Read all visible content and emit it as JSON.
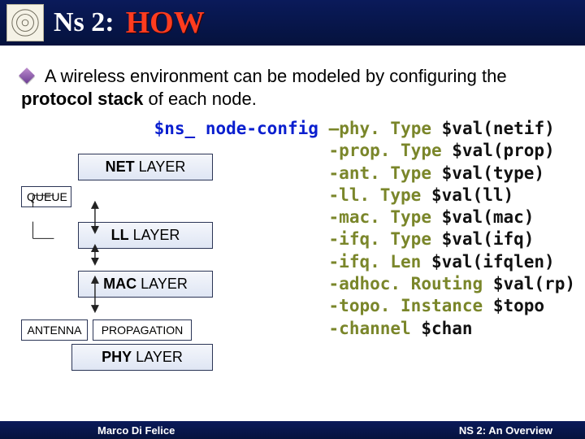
{
  "header": {
    "title_prefix": "Ns 2:",
    "title_highlight": "HOW"
  },
  "intro": {
    "part1": "A wireless environment can be modeled by configuring the ",
    "bold": "protocol stack",
    "part2": " of each node."
  },
  "diagram": {
    "layers": [
      "NET",
      "LL",
      "MAC",
      "PHY"
    ],
    "layer_suffix": " LAYER",
    "queue_label": "QUEUE",
    "antenna_label": "ANTENNA",
    "propagation_label": "PROPAGATION"
  },
  "code": {
    "head_obj": "$ns_",
    "head_cmd": "node-config",
    "lines": [
      {
        "opt": "–phy. Type",
        "arg": "$val(netif)"
      },
      {
        "opt": "-prop. Type",
        "arg": "$val(prop)"
      },
      {
        "opt": "-ant. Type",
        "arg": "$val(type)"
      },
      {
        "opt": "-ll. Type",
        "arg": "$val(ll)"
      },
      {
        "opt": "-mac. Type",
        "arg": "$val(mac)"
      },
      {
        "opt": "-ifq. Type",
        "arg": "$val(ifq)"
      },
      {
        "opt": "-ifq. Len",
        "arg": "$val(ifqlen)"
      },
      {
        "opt": "-adhoc. Routing",
        "arg": "$val(rp)"
      },
      {
        "opt": "-topo. Instance",
        "arg": "$topo"
      },
      {
        "opt": "-channel",
        "arg": "$chan"
      }
    ]
  },
  "footer": {
    "left": "Marco Di Felice",
    "right": "NS 2: An Overview"
  }
}
